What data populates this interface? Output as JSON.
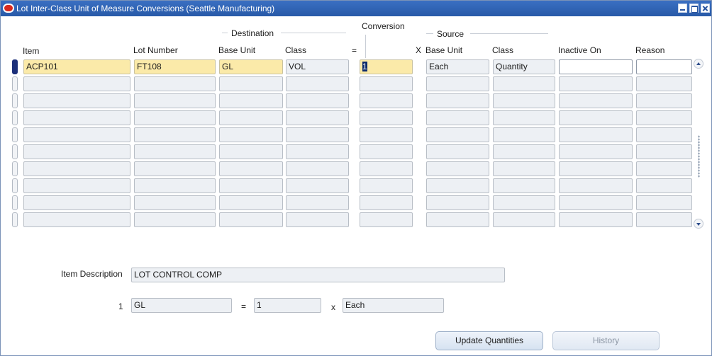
{
  "window": {
    "title": "Lot Inter-Class Unit of Measure Conversions (Seattle Manufacturing)"
  },
  "headers": {
    "destination": "Destination",
    "conversion": "Conversion",
    "source": "Source",
    "item": "Item",
    "lot_number": "Lot Number",
    "dest_base_unit": "Base Unit",
    "dest_class": "Class",
    "equals": "=",
    "times": "X",
    "src_base_unit": "Base Unit",
    "src_class": "Class",
    "inactive_on": "Inactive On",
    "reason": "Reason"
  },
  "rows": [
    {
      "item": "ACP101",
      "lot_number": "FT108",
      "dest_base_unit": "GL",
      "dest_class": "VOL",
      "conversion": "1",
      "src_base_unit": "Each",
      "src_class": "Quantity",
      "inactive_on": "",
      "reason": ""
    },
    {
      "item": "",
      "lot_number": "",
      "dest_base_unit": "",
      "dest_class": "",
      "conversion": "",
      "src_base_unit": "",
      "src_class": "",
      "inactive_on": "",
      "reason": ""
    },
    {
      "item": "",
      "lot_number": "",
      "dest_base_unit": "",
      "dest_class": "",
      "conversion": "",
      "src_base_unit": "",
      "src_class": "",
      "inactive_on": "",
      "reason": ""
    },
    {
      "item": "",
      "lot_number": "",
      "dest_base_unit": "",
      "dest_class": "",
      "conversion": "",
      "src_base_unit": "",
      "src_class": "",
      "inactive_on": "",
      "reason": ""
    },
    {
      "item": "",
      "lot_number": "",
      "dest_base_unit": "",
      "dest_class": "",
      "conversion": "",
      "src_base_unit": "",
      "src_class": "",
      "inactive_on": "",
      "reason": ""
    },
    {
      "item": "",
      "lot_number": "",
      "dest_base_unit": "",
      "dest_class": "",
      "conversion": "",
      "src_base_unit": "",
      "src_class": "",
      "inactive_on": "",
      "reason": ""
    },
    {
      "item": "",
      "lot_number": "",
      "dest_base_unit": "",
      "dest_class": "",
      "conversion": "",
      "src_base_unit": "",
      "src_class": "",
      "inactive_on": "",
      "reason": ""
    },
    {
      "item": "",
      "lot_number": "",
      "dest_base_unit": "",
      "dest_class": "",
      "conversion": "",
      "src_base_unit": "",
      "src_class": "",
      "inactive_on": "",
      "reason": ""
    },
    {
      "item": "",
      "lot_number": "",
      "dest_base_unit": "",
      "dest_class": "",
      "conversion": "",
      "src_base_unit": "",
      "src_class": "",
      "inactive_on": "",
      "reason": ""
    },
    {
      "item": "",
      "lot_number": "",
      "dest_base_unit": "",
      "dest_class": "",
      "conversion": "",
      "src_base_unit": "",
      "src_class": "",
      "inactive_on": "",
      "reason": ""
    }
  ],
  "detail": {
    "item_description_label": "Item Description",
    "item_description": "LOT CONTROL COMP",
    "qty_prefix": "1",
    "dest_unit": "GL",
    "equals": "=",
    "conversion": "1",
    "times": "x",
    "src_unit": "Each"
  },
  "buttons": {
    "update_quantities": "Update Quantities",
    "history": "History"
  },
  "colors": {
    "titlebar": "#285aa8",
    "required_field": "#fbeaa9",
    "readonly_field": "#edf0f4",
    "current_record_marker": "#1c2f7a"
  }
}
